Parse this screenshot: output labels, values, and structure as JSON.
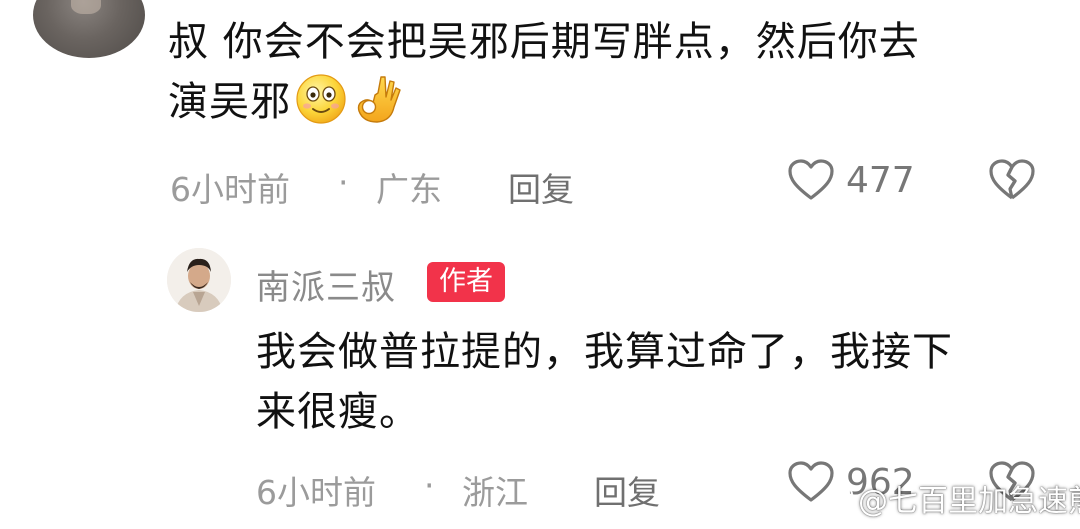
{
  "comments": [
    {
      "text_line1": "叔 你会不会把吴邪后期写胖点，然后你去",
      "text_line2": "演吴邪",
      "emojis": [
        "smile-emoji",
        "ok-hand-emoji"
      ],
      "time": "6小时前",
      "separator": "·",
      "location": "广东",
      "reply_label": "回复",
      "likes": "477"
    }
  ],
  "reply": {
    "author": "南派三叔",
    "badge": "作者",
    "text_line1": "我会做普拉提的，我算过命了，我接下",
    "text_line2": "来很瘦。",
    "time": "6小时前",
    "separator": "·",
    "location": "浙江",
    "reply_label": "回复",
    "likes": "962"
  },
  "watermark": "@七百里加急速煎饼",
  "colors": {
    "text": "#111111",
    "meta": "#9b9b9b",
    "badge_bg": "#f2334a"
  }
}
